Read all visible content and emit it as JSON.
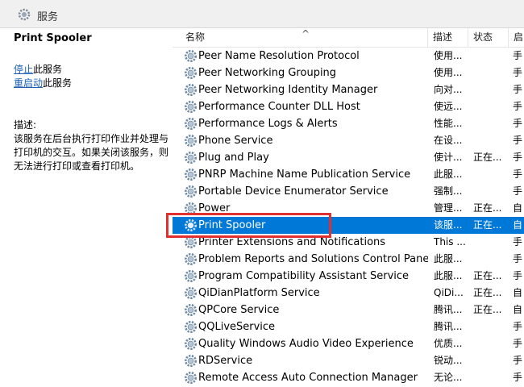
{
  "window": {
    "title": "服务"
  },
  "left_pane": {
    "service_title": "Print Spooler",
    "actions": [
      {
        "link": "停止",
        "suffix": "此服务"
      },
      {
        "link": "重启动",
        "suffix": "此服务"
      }
    ],
    "description_label": "描述:",
    "description": "该服务在后台执行打印作业并处理与打印机的交互。如果关闭该服务，则无法进行打印或查看打印机。"
  },
  "columns": {
    "name": "名称",
    "description": "描述",
    "status": "状态",
    "startup": "启"
  },
  "services": [
    {
      "name": "Peer Name Resolution Protocol",
      "desc": "使用...",
      "status": "",
      "startup": "手"
    },
    {
      "name": "Peer Networking Grouping",
      "desc": "使用...",
      "status": "",
      "startup": "手"
    },
    {
      "name": "Peer Networking Identity Manager",
      "desc": "向对...",
      "status": "",
      "startup": "手"
    },
    {
      "name": "Performance Counter DLL Host",
      "desc": "使远...",
      "status": "",
      "startup": "手"
    },
    {
      "name": "Performance Logs & Alerts",
      "desc": "性能...",
      "status": "",
      "startup": "手"
    },
    {
      "name": "Phone Service",
      "desc": "在设...",
      "status": "",
      "startup": "手"
    },
    {
      "name": "Plug and Play",
      "desc": "使计...",
      "status": "正在...",
      "startup": "手"
    },
    {
      "name": "PNRP Machine Name Publication Service",
      "desc": "此服...",
      "status": "",
      "startup": "手"
    },
    {
      "name": "Portable Device Enumerator Service",
      "desc": "强制...",
      "status": "",
      "startup": "手"
    },
    {
      "name": "Power",
      "desc": "管理...",
      "status": "正在...",
      "startup": "自"
    },
    {
      "name": "Print Spooler",
      "desc": "该服...",
      "status": "正在...",
      "startup": "自",
      "selected": true
    },
    {
      "name": "Printer Extensions and Notifications",
      "desc": "This ...",
      "status": "",
      "startup": "手"
    },
    {
      "name": "Problem Reports and Solutions Control Panel S...",
      "desc": "此服...",
      "status": "",
      "startup": "手"
    },
    {
      "name": "Program Compatibility Assistant Service",
      "desc": "此服...",
      "status": "正在...",
      "startup": "手"
    },
    {
      "name": "QiDianPlatform Service",
      "desc": "QiDi...",
      "status": "正在...",
      "startup": "自"
    },
    {
      "name": "QPCore Service",
      "desc": "腾讯...",
      "status": "正在...",
      "startup": "自"
    },
    {
      "name": "QQLiveService",
      "desc": "腾讯...",
      "status": "",
      "startup": "手"
    },
    {
      "name": "Quality Windows Audio Video Experience",
      "desc": "优质...",
      "status": "",
      "startup": "手"
    },
    {
      "name": "RDService",
      "desc": "锐动...",
      "status": "",
      "startup": "手"
    },
    {
      "name": "Remote Access Auto Connection Manager",
      "desc": "无论...",
      "status": "",
      "startup": "手"
    }
  ],
  "colors": {
    "selection": "#0078d7",
    "highlight_box": "#e03030",
    "link": "#1a5fb4"
  }
}
